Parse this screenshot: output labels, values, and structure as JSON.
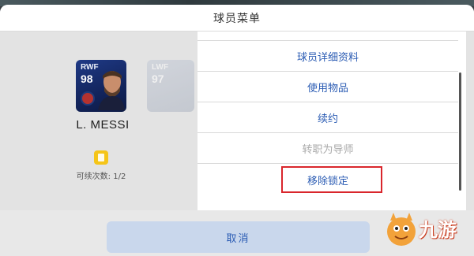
{
  "modal": {
    "title": "球员菜单"
  },
  "player": {
    "card_position": "RWF",
    "card_rating": "98",
    "next_card_position": "LWF",
    "next_card_rating": "97",
    "name": "L. MESSI",
    "renew_count_text": "可续次数: 1/2"
  },
  "menu": {
    "items": [
      {
        "label": "球员详细资料",
        "enabled": true
      },
      {
        "label": "使用物品",
        "enabled": true
      },
      {
        "label": "续约",
        "enabled": true
      },
      {
        "label": "转职为导师",
        "enabled": false
      },
      {
        "label": "移除锁定",
        "enabled": true,
        "highlighted": true
      }
    ]
  },
  "footer": {
    "cancel_label": "取消"
  },
  "watermark": {
    "text": "九游"
  },
  "colors": {
    "accent_text": "#2a5bb3",
    "disabled_text": "#a8a8a8",
    "highlight_border": "#d9262c",
    "cancel_bg": "#c9d7ec",
    "card_bg": "#1f3a86"
  }
}
